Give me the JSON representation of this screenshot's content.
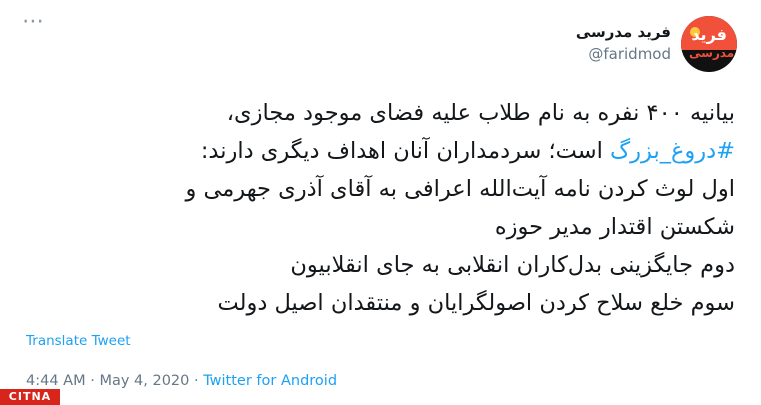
{
  "author": {
    "display_name": "فرید مدرسی",
    "handle": "@faridmod",
    "avatar_text_top": "فرید",
    "avatar_text_bottom": "مدرسی"
  },
  "more_icon": "more-dots-icon",
  "tweet": {
    "line1": "بیانیه ۴۰۰ نفره به نام طلاب علیه فضای موجود مجازی،",
    "line2_hashtag": "#دروغ_بزرگ",
    "line2_rest": " است؛ سردمداران آنان اهداف دیگری دارند:",
    "line3": "اول لوث کردن نامه آیت‌الله اعرافی به آقای آذری جهرمی و",
    "line4": "شکستن اقتدار مدیر حوزه",
    "line5": "دوم جایگزینی بدل‌کاران انقلابی به جای انقلابیون",
    "line6": "سوم خلع سلاح کردن اصولگرایان و منتقدان اصیل دولت"
  },
  "translate_label": "Translate Tweet",
  "meta": {
    "time": "4:44 AM",
    "separator1": " · ",
    "date": "May 4, 2020",
    "separator2": " · ",
    "source": "Twitter for Android"
  },
  "watermark": "CITNA",
  "colors": {
    "link": "#1da1f2",
    "secondary_text": "#657786",
    "primary_text": "#14171a",
    "watermark_bg": "#d8251b"
  }
}
